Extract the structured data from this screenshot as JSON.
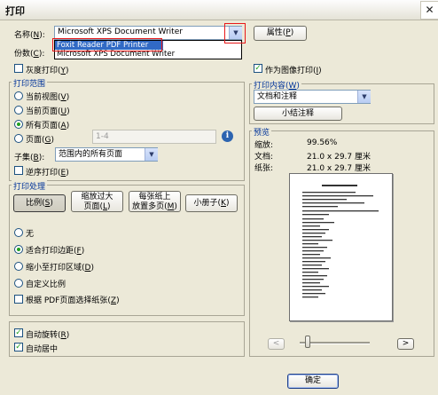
{
  "window": {
    "title": "打印",
    "close": "✕"
  },
  "printer": {
    "name_label": "名称(",
    "name_key": "N",
    "name_suffix": "):",
    "selected": "Microsoft XPS Document Writer",
    "dropdown_options": [
      "Foxit Reader PDF Printer",
      "Microsoft XPS Document Writer"
    ],
    "properties_label": "属性(",
    "properties_key": "P",
    "properties_suffix": ")",
    "copies_label": "份数(",
    "copies_key": "C",
    "copies_suffix": "):",
    "grayscale_label": "灰度打印(",
    "grayscale_key": "Y",
    "grayscale_suffix": ")",
    "print_as_image_label": "作为图像打印(",
    "print_as_image_key": "I",
    "print_as_image_suffix": ")"
  },
  "print_range": {
    "title": "打印范围",
    "current_view": "当前视图(",
    "current_view_key": "V",
    "current_page": "当前页面(",
    "current_page_key": "U",
    "all_pages": "所有页面(",
    "all_pages_key": "A",
    "pages": "页面(",
    "pages_key": "G",
    "pages_value": "1-4",
    "subset_label": "子集(",
    "subset_key": "B",
    "subset_suffix": "):",
    "subset_value": "范围内的所有页面",
    "reverse": "逆序打印(",
    "reverse_key": "E",
    "close_paren": ")"
  },
  "print_handling": {
    "title": "打印处理",
    "btn_scale": "比例(",
    "btn_scale_key": "S",
    "btn_shrink_1": "缩放过大",
    "btn_shrink_2": "页面(",
    "btn_shrink_key": "L",
    "btn_multi_1": "每张纸上",
    "btn_multi_2": "放置多页(",
    "btn_multi_key": "M",
    "btn_booklet": "小册子(",
    "btn_booklet_key": "K",
    "opt_none": "无",
    "opt_fit": "适合打印边距(",
    "opt_fit_key": "F",
    "opt_shrink": "缩小至打印区域(",
    "opt_shrink_key": "D",
    "opt_custom": "自定义比例",
    "opt_pdf_size": "根据 PDF页面选择纸张(",
    "opt_pdf_size_key": "Z",
    "close_paren": ")"
  },
  "auto": {
    "rotate": "自动旋转(",
    "rotate_key": "R",
    "center": "自动居中",
    "close_paren": ")"
  },
  "print_content": {
    "title": "打印内容(",
    "title_key": "W",
    "title_suffix": ")",
    "selected": "文档和注释",
    "summarize_btn": "小结注释"
  },
  "preview": {
    "title": "预览",
    "zoom_label": "缩放:",
    "zoom_value": "99.56%",
    "doc_label": "文档:",
    "doc_value": "21.0 x 29.7 厘米",
    "paper_label": "纸张:",
    "paper_value": "21.0 x 29.7 厘米",
    "prev": "<",
    "next": ">",
    "slider_position": 0.08
  },
  "ok_button": "确定"
}
